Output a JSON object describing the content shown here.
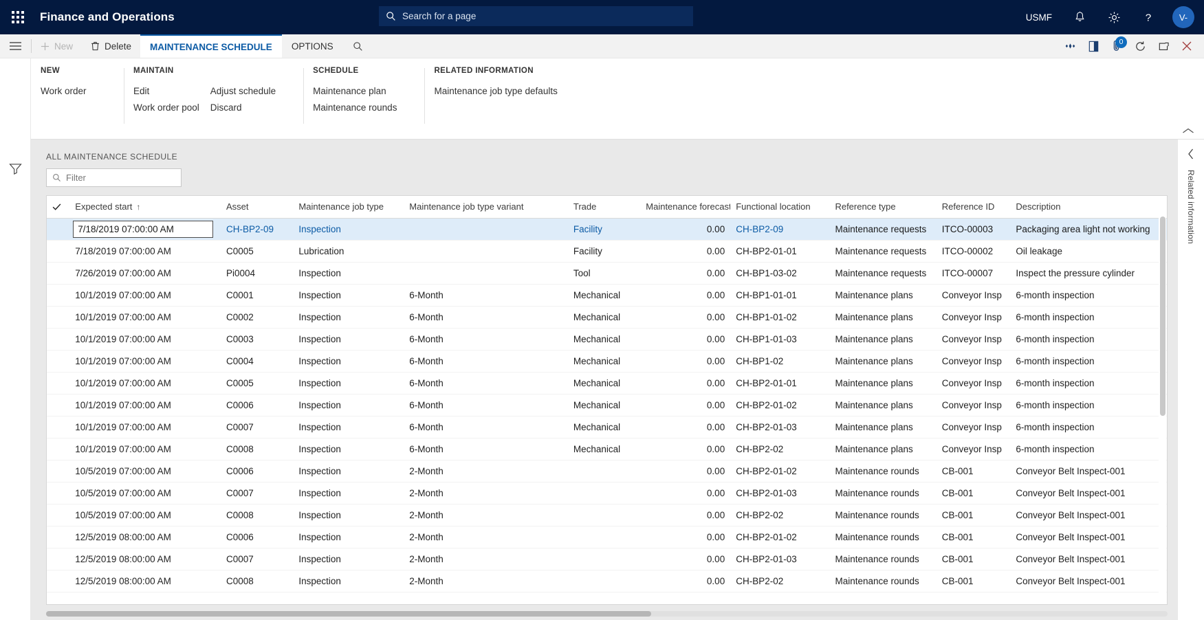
{
  "topnav": {
    "waffle": "app-launcher",
    "app_title": "Finance and Operations",
    "search_placeholder": "Search for a page",
    "company": "USMF",
    "notifications_icon": "bell-icon",
    "settings_icon": "gear-icon",
    "help_icon": "question-icon",
    "avatar_initials": "V-"
  },
  "actionpane": {
    "menu_icon": "hamburger-icon",
    "new_label": "New",
    "delete_label": "Delete",
    "tabs": [
      {
        "label": "MAINTENANCE SCHEDULE",
        "active": true
      },
      {
        "label": "OPTIONS",
        "active": false
      }
    ],
    "search_icon": "search-icon",
    "right_icons": [
      {
        "name": "share-icon"
      },
      {
        "name": "office-icon"
      },
      {
        "name": "attachment-icon",
        "badge": "0"
      },
      {
        "name": "refresh-icon"
      },
      {
        "name": "popout-icon"
      },
      {
        "name": "close-icon"
      }
    ]
  },
  "ribbon": {
    "groups": [
      {
        "title": "NEW",
        "columns": [
          [
            "Work order"
          ]
        ]
      },
      {
        "title": "MAINTAIN",
        "columns": [
          [
            "Edit",
            "Work order pool"
          ],
          [
            "Adjust schedule",
            "Discard"
          ]
        ]
      },
      {
        "title": "SCHEDULE",
        "columns": [
          [
            "Maintenance plan",
            "Maintenance rounds"
          ]
        ]
      },
      {
        "title": "RELATED INFORMATION",
        "columns": [
          [
            "Maintenance job type defaults"
          ]
        ]
      }
    ],
    "collapse_icon": "chevron-up-icon"
  },
  "rightrail": {
    "collapse_icon": "chevron-left-icon",
    "label": "Related information"
  },
  "leftrail": {
    "filter_icon": "filter-icon"
  },
  "grid": {
    "caption": "ALL MAINTENANCE SCHEDULE",
    "filter_placeholder": "Filter",
    "select_all_icon": "checkmark-icon",
    "sort_indicator": "↑",
    "columns": [
      "Expected start",
      "Asset",
      "Maintenance job type",
      "Maintenance job type variant",
      "Trade",
      "Maintenance forecast...",
      "Functional location",
      "Reference type",
      "Reference ID",
      "Description"
    ],
    "rows": [
      {
        "selected": true,
        "editing": true,
        "expected_start": "7/18/2019 07:00:00 AM",
        "asset": "CH-BP2-09",
        "job_type": "Inspection",
        "variant": "",
        "trade": "Facility",
        "forecast": "0.00",
        "location": "CH-BP2-09",
        "ref_type": "Maintenance requests",
        "ref_id": "ITCO-00003",
        "description": "Packaging area light not working"
      },
      {
        "expected_start": "7/18/2019 07:00:00 AM",
        "asset": "C0005",
        "job_type": "Lubrication",
        "variant": "",
        "trade": "Facility",
        "forecast": "0.00",
        "location": "CH-BP2-01-01",
        "ref_type": "Maintenance requests",
        "ref_id": "ITCO-00002",
        "description": "Oil leakage"
      },
      {
        "expected_start": "7/26/2019 07:00:00 AM",
        "asset": "Pi0004",
        "job_type": "Inspection",
        "variant": "",
        "trade": "Tool",
        "forecast": "0.00",
        "location": "CH-BP1-03-02",
        "ref_type": "Maintenance requests",
        "ref_id": "ITCO-00007",
        "description": "Inspect the pressure cylinder"
      },
      {
        "expected_start": "10/1/2019 07:00:00 AM",
        "asset": "C0001",
        "job_type": "Inspection",
        "variant": "6-Month",
        "trade": "Mechanical",
        "forecast": "0.00",
        "location": "CH-BP1-01-01",
        "ref_type": "Maintenance plans",
        "ref_id": "Conveyor Insp",
        "description": "6-month inspection"
      },
      {
        "expected_start": "10/1/2019 07:00:00 AM",
        "asset": "C0002",
        "job_type": "Inspection",
        "variant": "6-Month",
        "trade": "Mechanical",
        "forecast": "0.00",
        "location": "CH-BP1-01-02",
        "ref_type": "Maintenance plans",
        "ref_id": "Conveyor Insp",
        "description": "6-month inspection"
      },
      {
        "expected_start": "10/1/2019 07:00:00 AM",
        "asset": "C0003",
        "job_type": "Inspection",
        "variant": "6-Month",
        "trade": "Mechanical",
        "forecast": "0.00",
        "location": "CH-BP1-01-03",
        "ref_type": "Maintenance plans",
        "ref_id": "Conveyor Insp",
        "description": "6-month inspection"
      },
      {
        "expected_start": "10/1/2019 07:00:00 AM",
        "asset": "C0004",
        "job_type": "Inspection",
        "variant": "6-Month",
        "trade": "Mechanical",
        "forecast": "0.00",
        "location": "CH-BP1-02",
        "ref_type": "Maintenance plans",
        "ref_id": "Conveyor Insp",
        "description": "6-month inspection"
      },
      {
        "expected_start": "10/1/2019 07:00:00 AM",
        "asset": "C0005",
        "job_type": "Inspection",
        "variant": "6-Month",
        "trade": "Mechanical",
        "forecast": "0.00",
        "location": "CH-BP2-01-01",
        "ref_type": "Maintenance plans",
        "ref_id": "Conveyor Insp",
        "description": "6-month inspection"
      },
      {
        "expected_start": "10/1/2019 07:00:00 AM",
        "asset": "C0006",
        "job_type": "Inspection",
        "variant": "6-Month",
        "trade": "Mechanical",
        "forecast": "0.00",
        "location": "CH-BP2-01-02",
        "ref_type": "Maintenance plans",
        "ref_id": "Conveyor Insp",
        "description": "6-month inspection"
      },
      {
        "expected_start": "10/1/2019 07:00:00 AM",
        "asset": "C0007",
        "job_type": "Inspection",
        "variant": "6-Month",
        "trade": "Mechanical",
        "forecast": "0.00",
        "location": "CH-BP2-01-03",
        "ref_type": "Maintenance plans",
        "ref_id": "Conveyor Insp",
        "description": "6-month inspection"
      },
      {
        "expected_start": "10/1/2019 07:00:00 AM",
        "asset": "C0008",
        "job_type": "Inspection",
        "variant": "6-Month",
        "trade": "Mechanical",
        "forecast": "0.00",
        "location": "CH-BP2-02",
        "ref_type": "Maintenance plans",
        "ref_id": "Conveyor Insp",
        "description": "6-month inspection"
      },
      {
        "expected_start": "10/5/2019 07:00:00 AM",
        "asset": "C0006",
        "job_type": "Inspection",
        "variant": "2-Month",
        "trade": "",
        "forecast": "0.00",
        "location": "CH-BP2-01-02",
        "ref_type": "Maintenance rounds",
        "ref_id": "CB-001",
        "description": "Conveyor Belt Inspect-001"
      },
      {
        "expected_start": "10/5/2019 07:00:00 AM",
        "asset": "C0007",
        "job_type": "Inspection",
        "variant": "2-Month",
        "trade": "",
        "forecast": "0.00",
        "location": "CH-BP2-01-03",
        "ref_type": "Maintenance rounds",
        "ref_id": "CB-001",
        "description": "Conveyor Belt Inspect-001"
      },
      {
        "expected_start": "10/5/2019 07:00:00 AM",
        "asset": "C0008",
        "job_type": "Inspection",
        "variant": "2-Month",
        "trade": "",
        "forecast": "0.00",
        "location": "CH-BP2-02",
        "ref_type": "Maintenance rounds",
        "ref_id": "CB-001",
        "description": "Conveyor Belt Inspect-001"
      },
      {
        "expected_start": "12/5/2019 08:00:00 AM",
        "asset": "C0006",
        "job_type": "Inspection",
        "variant": "2-Month",
        "trade": "",
        "forecast": "0.00",
        "location": "CH-BP2-01-02",
        "ref_type": "Maintenance rounds",
        "ref_id": "CB-001",
        "description": "Conveyor Belt Inspect-001"
      },
      {
        "expected_start": "12/5/2019 08:00:00 AM",
        "asset": "C0007",
        "job_type": "Inspection",
        "variant": "2-Month",
        "trade": "",
        "forecast": "0.00",
        "location": "CH-BP2-01-03",
        "ref_type": "Maintenance rounds",
        "ref_id": "CB-001",
        "description": "Conveyor Belt Inspect-001"
      },
      {
        "expected_start": "12/5/2019 08:00:00 AM",
        "asset": "C0008",
        "job_type": "Inspection",
        "variant": "2-Month",
        "trade": "",
        "forecast": "0.00",
        "location": "CH-BP2-02",
        "ref_type": "Maintenance rounds",
        "ref_id": "CB-001",
        "description": "Conveyor Belt Inspect-001"
      }
    ]
  },
  "colors": {
    "nav_bg": "#03193f",
    "accent": "#0c5ba5",
    "selected_row": "#deecf9",
    "badge": "#0f6cbd"
  }
}
